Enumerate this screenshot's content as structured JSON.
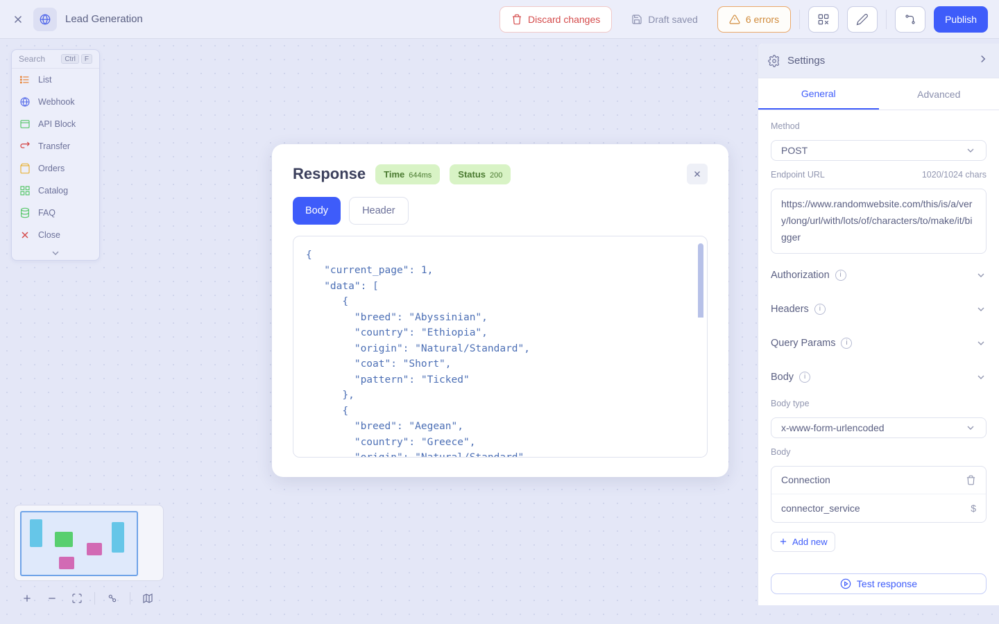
{
  "header": {
    "title": "Lead Generation",
    "discard": "Discard changes",
    "draft": "Draft saved",
    "errors_count": "6 errors",
    "publish": "Publish"
  },
  "palette": {
    "search_label": "Search",
    "shortcut_key1": "Ctrl",
    "shortcut_key2": "F",
    "items": [
      {
        "label": "List"
      },
      {
        "label": "Webhook"
      },
      {
        "label": "API Block"
      },
      {
        "label": "Transfer"
      },
      {
        "label": "Orders"
      },
      {
        "label": "Catalog"
      },
      {
        "label": "FAQ"
      },
      {
        "label": "Close"
      }
    ]
  },
  "response_modal": {
    "title": "Response",
    "time_label": "Time",
    "time_value": "644ms",
    "status_label": "Status",
    "status_value": "200",
    "tab_body": "Body",
    "tab_header": "Header",
    "body_text": "{\n   \"current_page\": 1,\n   \"data\": [\n      {\n        \"breed\": \"Abyssinian\",\n        \"country\": \"Ethiopia\",\n        \"origin\": \"Natural/Standard\",\n        \"coat\": \"Short\",\n        \"pattern\": \"Ticked\"\n      },\n      {\n        \"breed\": \"Aegean\",\n        \"country\": \"Greece\",\n        \"origin\": \"Natural/Standard\","
  },
  "settings": {
    "title": "Settings",
    "tabs": {
      "general": "General",
      "advanced": "Advanced"
    },
    "method_label": "Method",
    "method_value": "POST",
    "endpoint_label": "Endpoint URL",
    "endpoint_count": "1020/1024 chars",
    "endpoint_value": "https://www.randomwebsite.com/this/is/a/very/long/url/with/lots/of/characters/to/make/it/bigger",
    "sections": {
      "authorization": "Authorization",
      "headers": "Headers",
      "query_params": "Query Params",
      "body": "Body"
    },
    "body_type_label": "Body type",
    "body_type_value": "x-www-form-urlencoded",
    "body_label": "Body",
    "body_rows": [
      {
        "key": "Connection"
      },
      {
        "key": "connector_service"
      }
    ],
    "add_new": "Add new",
    "test": "Test response"
  }
}
